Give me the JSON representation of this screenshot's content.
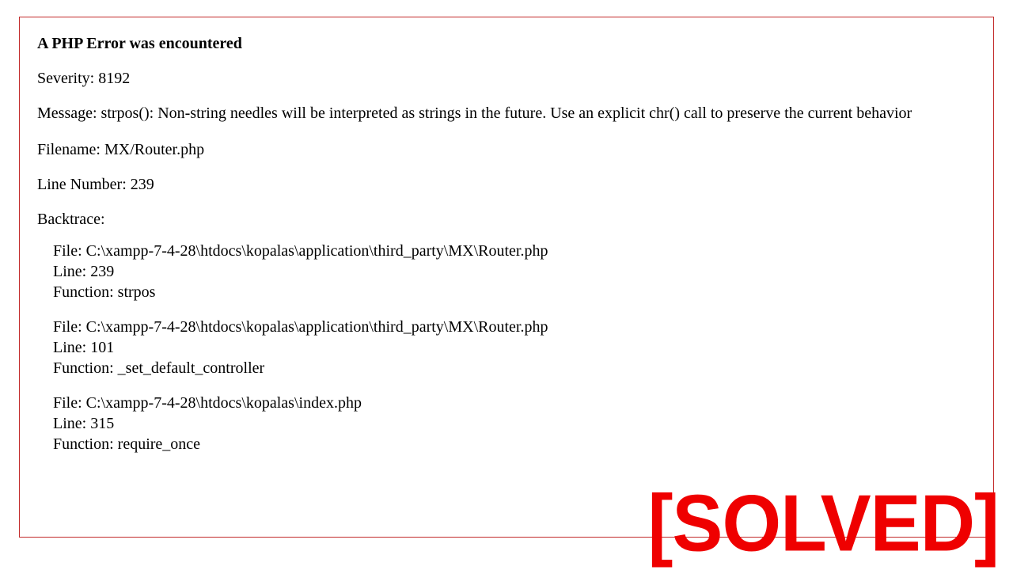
{
  "error": {
    "title": "A PHP Error was encountered",
    "severity_label": "Severity: ",
    "severity_value": "8192",
    "message_label": "Message: ",
    "message_value": "strpos(): Non-string needles will be interpreted as strings in the future. Use an explicit chr() call to preserve the current behavior",
    "filename_label": "Filename: ",
    "filename_value": "MX/Router.php",
    "linenum_label": "Line Number: ",
    "linenum_value": "239",
    "backtrace_label": "Backtrace:",
    "backtrace": [
      {
        "file_label": "File: ",
        "file_value": "C:\\xampp-7-4-28\\htdocs\\kopalas\\application\\third_party\\MX\\Router.php",
        "line_label": "Line: ",
        "line_value": "239",
        "func_label": "Function: ",
        "func_value": "strpos"
      },
      {
        "file_label": "File: ",
        "file_value": "C:\\xampp-7-4-28\\htdocs\\kopalas\\application\\third_party\\MX\\Router.php",
        "line_label": "Line: ",
        "line_value": "101",
        "func_label": "Function: ",
        "func_value": "_set_default_controller"
      },
      {
        "file_label": "File: ",
        "file_value": "C:\\xampp-7-4-28\\htdocs\\kopalas\\index.php",
        "line_label": "Line: ",
        "line_value": "315",
        "func_label": "Function: ",
        "func_value": "require_once"
      }
    ]
  },
  "overlay": {
    "solved_text": "[SOLVED]"
  }
}
